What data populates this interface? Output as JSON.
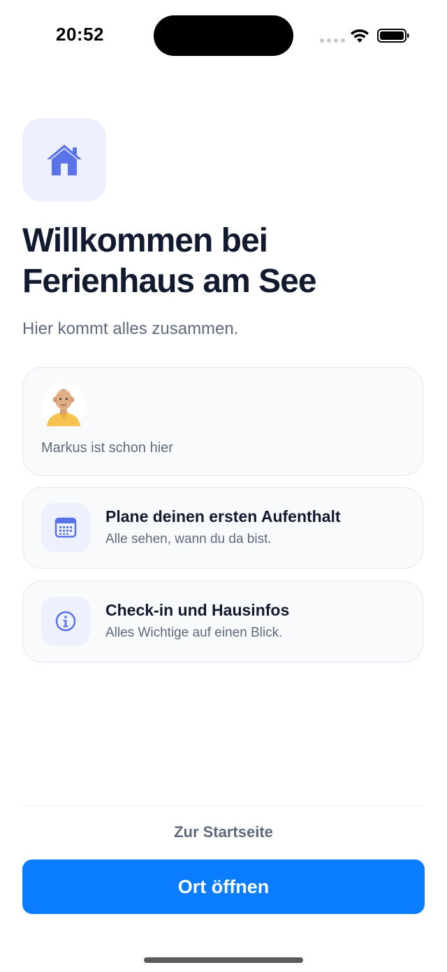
{
  "status_bar": {
    "time": "20:52",
    "icons": [
      "cellular-signal-icon",
      "wifi-icon",
      "battery-icon"
    ]
  },
  "header": {
    "icon": "house-icon",
    "title_line1": "Willkommen bei",
    "title_line2": "Ferienhaus am See",
    "subtitle": "Hier kommt alles zusammen."
  },
  "members_card": {
    "avatar": "person-avatar",
    "text": "Markus ist schon hier"
  },
  "actions": [
    {
      "icon": "calendar-icon",
      "title": "Plane deinen ersten Aufenthalt",
      "subtitle": "Alle sehen, wann du da bist."
    },
    {
      "icon": "info-icon",
      "title": "Check-in und Hausinfos",
      "subtitle": "Alles Wichtige auf einen Blick."
    }
  ],
  "footer": {
    "secondary_label": "Zur Startseite",
    "primary_label": "Ort öffnen"
  },
  "colors": {
    "accent": "#0a7cff",
    "icon_blue": "#5b73e8",
    "icon_bg": "#edf1fd",
    "title": "#111a2e",
    "muted": "#5f6b7d"
  }
}
